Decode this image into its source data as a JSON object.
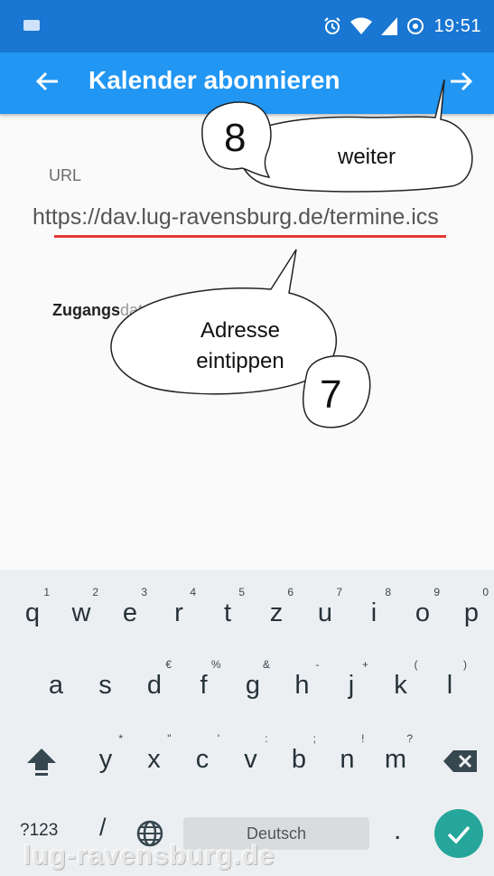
{
  "status_bar": {
    "time": "19:51"
  },
  "app_bar": {
    "title": "Kalender abonnieren"
  },
  "form": {
    "url_label": "URL",
    "url_value": "https://dav.lug-ravensburg.de/termine.ics",
    "credentials_label_bold": "Zugangs",
    "credentials_label_faded": "daten benötigt"
  },
  "annotations": {
    "next_text": "weiter",
    "next_number": "8",
    "address_text_line1": "Adresse",
    "address_text_line2": "eintippen",
    "address_number": "7"
  },
  "keyboard": {
    "row1": [
      {
        "key": "q",
        "hint": "1"
      },
      {
        "key": "w",
        "hint": "2"
      },
      {
        "key": "e",
        "hint": "3"
      },
      {
        "key": "r",
        "hint": "4"
      },
      {
        "key": "t",
        "hint": "5"
      },
      {
        "key": "z",
        "hint": "6"
      },
      {
        "key": "u",
        "hint": "7"
      },
      {
        "key": "i",
        "hint": "8"
      },
      {
        "key": "o",
        "hint": "9"
      },
      {
        "key": "p",
        "hint": "0"
      }
    ],
    "row2": [
      {
        "key": "a",
        "hint": ""
      },
      {
        "key": "s",
        "hint": ""
      },
      {
        "key": "d",
        "hint": "€"
      },
      {
        "key": "f",
        "hint": "%"
      },
      {
        "key": "g",
        "hint": "&"
      },
      {
        "key": "h",
        "hint": "-"
      },
      {
        "key": "j",
        "hint": "+"
      },
      {
        "key": "k",
        "hint": "("
      },
      {
        "key": "l",
        "hint": ")"
      }
    ],
    "row3": [
      {
        "key": "y",
        "hint": "*"
      },
      {
        "key": "x",
        "hint": "\""
      },
      {
        "key": "c",
        "hint": "'"
      },
      {
        "key": "v",
        "hint": ":"
      },
      {
        "key": "b",
        "hint": ";"
      },
      {
        "key": "n",
        "hint": "!"
      },
      {
        "key": "m",
        "hint": "?"
      }
    ],
    "symbols_label": "?123",
    "slash_label": "/",
    "space_label": "Deutsch",
    "period_label": "."
  },
  "watermark": "lug-ravensburg.de",
  "colors": {
    "statusbar": "#1976d2",
    "appbar": "#2196f3",
    "underline": "#e53935",
    "enter": "#26a69a"
  }
}
